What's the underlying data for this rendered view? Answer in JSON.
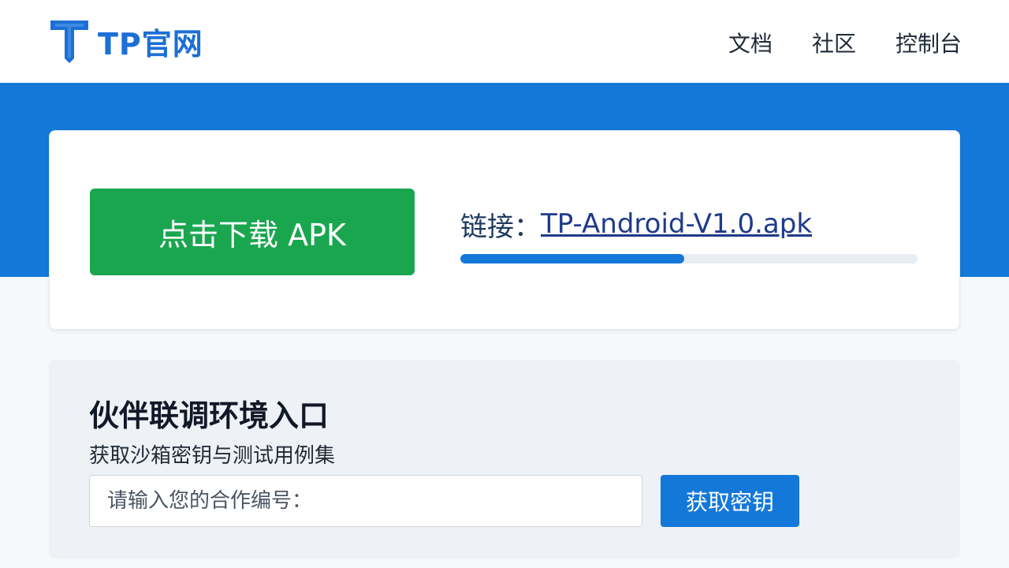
{
  "header": {
    "logo_text": "TP官网",
    "logo_icon": "tp-logo-icon",
    "nav": [
      {
        "label": "文档"
      },
      {
        "label": "社区"
      },
      {
        "label": "控制台"
      }
    ]
  },
  "download": {
    "button_label": "点击下载 APK",
    "link_prefix": "链接：",
    "link_text": "TP-Android-V1.0.apk",
    "progress_fraction": 0.49
  },
  "partner": {
    "title": "伙伴联调环境入口",
    "subtitle": "获取沙箱密钥与测试用例集",
    "input_placeholder": "请输入您的合作编号：",
    "input_value": "",
    "button_label": "获取密钥"
  },
  "colors": {
    "brand_blue": "#1478d9",
    "download_green": "#1aa64f",
    "logo_blue": "#1d6fd6"
  }
}
